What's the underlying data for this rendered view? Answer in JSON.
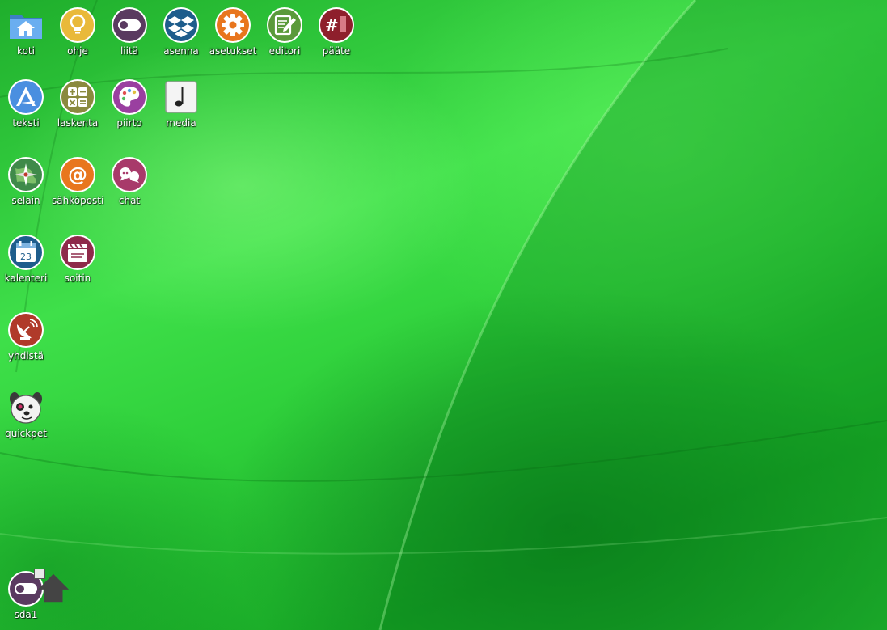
{
  "desktop": {
    "icons": [
      {
        "label": "koti",
        "icon": "home-folder-icon"
      },
      {
        "label": "ohje",
        "icon": "lightbulb-icon"
      },
      {
        "label": "liitä",
        "icon": "toggle-icon"
      },
      {
        "label": "asenna",
        "icon": "dropbox-box-icon"
      },
      {
        "label": "asetukset",
        "icon": "gear-icon"
      },
      {
        "label": "editori",
        "icon": "notepad-pencil-icon"
      },
      {
        "label": "pääte",
        "icon": "terminal-hash-icon"
      },
      {
        "label": "teksti",
        "icon": "text-a-icon"
      },
      {
        "label": "laskenta",
        "icon": "calculator-icon"
      },
      {
        "label": "piirto",
        "icon": "palette-icon"
      },
      {
        "label": "media",
        "icon": "music-note-icon"
      },
      {
        "label": "selain",
        "icon": "compass-globe-icon"
      },
      {
        "label": "sähköposti",
        "icon": "at-sign-icon"
      },
      {
        "label": "chat",
        "icon": "chat-bubbles-icon"
      },
      {
        "label": "kalenteri",
        "icon": "calendar-icon"
      },
      {
        "label": "soitin",
        "icon": "clapperboard-icon"
      },
      {
        "label": "yhdistä",
        "icon": "satellite-dish-icon"
      },
      {
        "label": "quickpet",
        "icon": "puppy-face-icon"
      },
      {
        "label": "sda1",
        "icon": "drive-toggle-icon"
      }
    ],
    "calendar_day": "23",
    "colors": {
      "wallpaper_green": "#2ecf3a",
      "label_text": "#ffffff"
    }
  }
}
